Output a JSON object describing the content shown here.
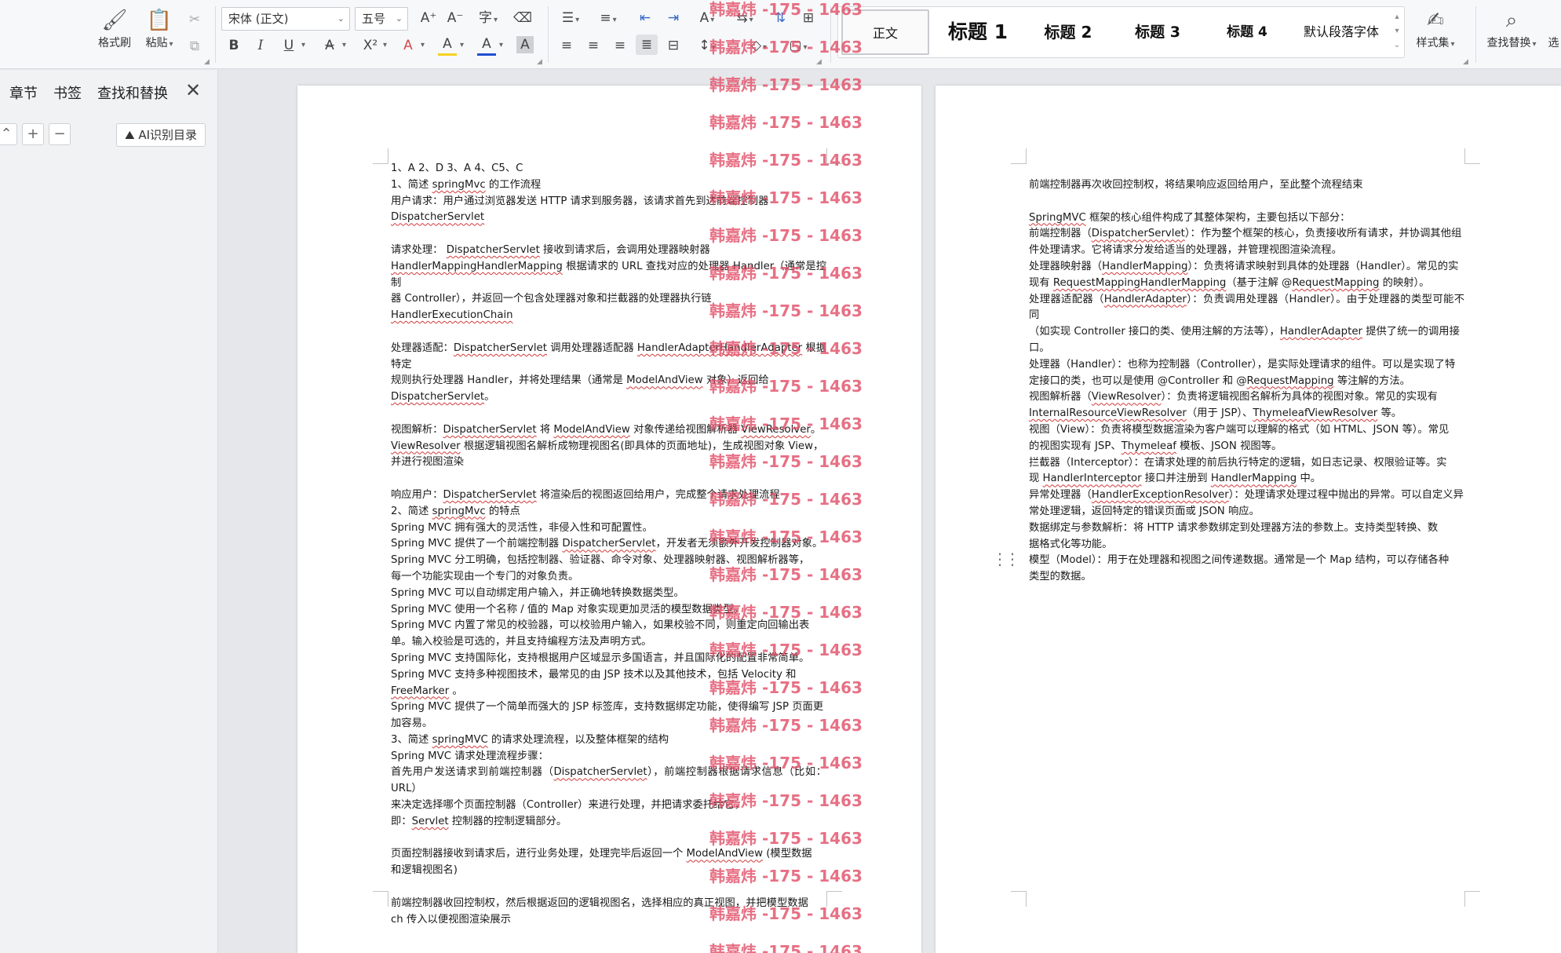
{
  "ribbon": {
    "format_painter": "格式刷",
    "paste": "粘贴",
    "font_name": "宋体 (正文)",
    "font_size": "五号",
    "styles": [
      "正文",
      "标题 1",
      "标题 2",
      "标题 3",
      "标题 4",
      "默认段落字体"
    ],
    "style_set": "样式集",
    "find_replace": "查找替换",
    "more": "选",
    "bold": "B",
    "italic": "I",
    "underline": "U",
    "strikethrough": "A",
    "superscript": "X²",
    "font_color": "A",
    "highlight": "A",
    "shading": "A",
    "char_border": "A"
  },
  "nav": {
    "tabs": [
      "章节",
      "书签",
      "查找和替换"
    ],
    "close": "✕",
    "collapse": "⌃",
    "expand": "+",
    "minus": "−",
    "ai_button": "AI识别目录"
  },
  "watermark": "韩嘉炜 -175 - 1463",
  "page1": [
    [
      {
        "t": "1、A 2、D 3、A 4、C5、C"
      }
    ],
    [
      {
        "t": "1、简述 "
      },
      {
        "t": "springMvc",
        "u": true
      },
      {
        "t": " 的工作流程"
      }
    ],
    [
      {
        "t": "用户请求：用户通过浏览器发送 HTTP 请求到服务器，该请求首先到达前端控制器"
      }
    ],
    [
      {
        "t": "DispatcherServlet",
        "u": true
      }
    ],
    [],
    [
      {
        "t": "请求处理：  "
      },
      {
        "t": "DispatcherServlet",
        "u": true
      },
      {
        "t": "  接收到请求后，会调用处理器映射器"
      }
    ],
    [
      {
        "t": "HandlerMappingHandlerMapping",
        "u": true
      },
      {
        "t": " 根据请求的 URL 查找对应的处理器 Handler（通常是控制"
      }
    ],
    [
      {
        "t": "器  Controller），并返回一个包含处理器对象和拦截器的处理器执行链"
      }
    ],
    [
      {
        "t": "HandlerExecutionChain",
        "u": true
      }
    ],
    [],
    [
      {
        "t": "处理器适配："
      },
      {
        "t": "DispatcherServlet",
        "u": true
      },
      {
        "t": " 调用处理器适配器 "
      },
      {
        "t": "HandlerAdapterHandlerAdapter",
        "u": true
      },
      {
        "t": " 根据特定"
      }
    ],
    [
      {
        "t": "规则执行处理器  Handler，并将处理结果（通常是  "
      },
      {
        "t": "ModelAndView",
        "u": true
      },
      {
        "t": " 对象）返回给"
      }
    ],
    [
      {
        "t": "DispatcherServlet",
        "u": true
      },
      {
        "t": "。"
      }
    ],
    [],
    [
      {
        "t": "视图解析："
      },
      {
        "t": "DispatcherServlet",
        "u": true
      },
      {
        "t": " 将 "
      },
      {
        "t": "ModelAndView",
        "u": true
      },
      {
        "t": " 对象传递给视图解析器 "
      },
      {
        "t": "ViewResolver",
        "u": true
      },
      {
        "t": "。"
      }
    ],
    [
      {
        "t": "ViewResolver",
        "u": true
      },
      {
        "t": " 根据逻辑视图名解析成物理视图名(即具体的页面地址)，生成视图对象 View，"
      }
    ],
    [
      {
        "t": "并进行视图渲染"
      }
    ],
    [],
    [
      {
        "t": "响应用户："
      },
      {
        "t": "DispatcherServlet",
        "u": true
      },
      {
        "t": " 将渲染后的视图返回给用户，完成整个请求处理流程"
      }
    ],
    [
      {
        "t": "2、简述 "
      },
      {
        "t": "springMvc",
        "u": true
      },
      {
        "t": " 的特点"
      }
    ],
    [
      {
        "t": "Spring MVC 拥有强大的灵活性，非侵入性和可配置性。"
      }
    ],
    [
      {
        "t": "Spring MVC 提供了一个前端控制器 "
      },
      {
        "t": "DispatcherServlet",
        "u": true
      },
      {
        "t": "，开发者无须额外开发控制器对象。"
      }
    ],
    [
      {
        "t": "Spring MVC 分工明确，包括控制器、验证器、命令对象、处理器映射器、视图解析器等，"
      }
    ],
    [
      {
        "t": "每一个功能实现由一个专门的对象负责。"
      }
    ],
    [
      {
        "t": "Spring MVC 可以自动绑定用户输入，并正确地转换数据类型。"
      }
    ],
    [
      {
        "t": "Spring MVC 使用一个名称 / 值的 Map 对象实现更加灵活的模型数据类型。"
      }
    ],
    [
      {
        "t": "Spring MVC 内置了常见的校验器，可以校验用户输入，如果校验不同，则重定向回输出表"
      }
    ],
    [
      {
        "t": "单。输入校验是可选的，并且支持编程方法及声明方式。"
      }
    ],
    [
      {
        "t": "Spring MVC 支持国际化，支持根据用户区域显示多国语言，并且国际化的配置非常简单。"
      }
    ],
    [
      {
        "t": "Spring MVC 支持多种视图技术，最常见的由 JSP 技术以及其他技术，包括 Velocity 和"
      }
    ],
    [
      {
        "t": "FreeMarker",
        "u": true
      },
      {
        "t": " 。"
      }
    ],
    [
      {
        "t": "Spring MVC 提供了一个简单而强大的 JSP 标签库，支持数据绑定功能，使得编写 JSP 页面更"
      }
    ],
    [
      {
        "t": "加容易。"
      }
    ],
    [
      {
        "t": "3、简述 "
      },
      {
        "t": "springMVC",
        "u": true
      },
      {
        "t": " 的请求处理流程，以及整体框架的结构"
      }
    ],
    [
      {
        "t": "Spring MVC 请求处理流程步骤："
      }
    ],
    [
      {
        "t": "首先用户发送请求到前端控制器（"
      },
      {
        "t": "DispatcherServlet",
        "u": true
      },
      {
        "t": "），前端控制器根据请求信息（比如：URL）"
      }
    ],
    [
      {
        "t": "来决定选择哪个页面控制器（Controller）来进行处理，并把请求委托给它，"
      }
    ],
    [
      {
        "t": "即："
      },
      {
        "t": "Servlet",
        "u": true
      },
      {
        "t": " 控制器的控制逻辑部分。"
      }
    ],
    [],
    [
      {
        "t": "页面控制器接收到请求后，进行业务处理，处理完毕后返回一个 "
      },
      {
        "t": "ModelAndView",
        "u": true
      },
      {
        "t": " (模型数据"
      }
    ],
    [
      {
        "t": "和逻辑视图名)"
      }
    ],
    [],
    [
      {
        "t": "前端控制器收回控制权，然后根据返回的逻辑视图名，选择相应的真正视图，并把模型数据"
      }
    ],
    [
      {
        "t": "ch 传入以便视图渲染展示"
      }
    ]
  ],
  "page2": [
    [
      {
        "t": "前端控制器再次收回控制权，将结果响应返回给用户，至此整个流程结束"
      }
    ],
    [],
    [
      {
        "t": "SpringMVC",
        "u": true
      },
      {
        "t": " 框架的核心组件构成了其整体架构，主要包括以下部分："
      }
    ],
    [
      {
        "t": "前端控制器（"
      },
      {
        "t": "DispatcherServlet",
        "u": true
      },
      {
        "t": "）：作为整个框架的核心，负责接收所有请求，并协调其他组"
      }
    ],
    [
      {
        "t": "件处理请求。它将请求分发给适当的处理器，并管理视图渲染流程。"
      }
    ],
    [
      {
        "t": "处理器映射器（"
      },
      {
        "t": "HandlerMapping",
        "u": true
      },
      {
        "t": "）：负责将请求映射到具体的处理器（Handler）。常见的实"
      }
    ],
    [
      {
        "t": "现有 "
      },
      {
        "t": "RequestMappingHandlerMapping",
        "u": true
      },
      {
        "t": "（基于注解 @"
      },
      {
        "t": "RequestMapping",
        "u": true
      },
      {
        "t": " 的映射）。"
      }
    ],
    [
      {
        "t": "处理器适配器（"
      },
      {
        "t": "HandlerAdapter",
        "u": true
      },
      {
        "t": "）：负责调用处理器（Handler）。由于处理器的类型可能不同"
      }
    ],
    [
      {
        "t": "（如实现 Controller 接口的类、使用注解的方法等），"
      },
      {
        "t": "HandlerAdapter",
        "u": true
      },
      {
        "t": " 提供了统一的调用接"
      }
    ],
    [
      {
        "t": "口。"
      }
    ],
    [
      {
        "t": "处理器（Handler）：也称为控制器（Controller），是实际处理请求的组件。可以是实现了特"
      }
    ],
    [
      {
        "t": "定接口的类，也可以是使用 @Controller 和 @"
      },
      {
        "t": "RequestMapping",
        "u": true
      },
      {
        "t": " 等注解的方法。"
      }
    ],
    [
      {
        "t": "视图解析器（"
      },
      {
        "t": "ViewResolver",
        "u": true
      },
      {
        "t": "）：负责将逻辑视图名解析为具体的视图对象。常见的实现有"
      }
    ],
    [
      {
        "t": "InternalResourceViewResolver",
        "u": true
      },
      {
        "t": "（用于 JSP）、"
      },
      {
        "t": "ThymeleafViewResolver",
        "u": true
      },
      {
        "t": " 等。"
      }
    ],
    [
      {
        "t": "视图（View）：负责将模型数据渲染为客户端可以理解的格式（如 HTML、JSON 等）。常见"
      }
    ],
    [
      {
        "t": "的视图实现有 JSP、"
      },
      {
        "t": "Thymeleaf",
        "u": true
      },
      {
        "t": " 模板、JSON 视图等。"
      }
    ],
    [
      {
        "t": "拦截器（Interceptor）：在请求处理的前后执行特定的逻辑，如日志记录、权限验证等。实"
      }
    ],
    [
      {
        "t": "现 "
      },
      {
        "t": "HandlerInterceptor",
        "u": true
      },
      {
        "t": " 接口并注册到 "
      },
      {
        "t": "HandlerMapping",
        "u": true
      },
      {
        "t": " 中。"
      }
    ],
    [
      {
        "t": "异常处理器（"
      },
      {
        "t": "HandlerExceptionResolver",
        "u": true
      },
      {
        "t": "）：处理请求处理过程中抛出的异常。可以自定义异"
      }
    ],
    [
      {
        "t": "常处理逻辑，返回特定的错误页面或 JSON 响应。"
      }
    ],
    [
      {
        "t": "数据绑定与参数解析：将 HTTP 请求参数绑定到处理器方法的参数上。支持类型转换、数"
      }
    ],
    [
      {
        "t": "据格式化等功能。"
      }
    ],
    [
      {
        "t": "模型（Model）：用于在处理器和视图之间传递数据。通常是一个 Map 结构，可以存储各种"
      }
    ],
    [
      {
        "t": "类型的数据。"
      }
    ]
  ]
}
